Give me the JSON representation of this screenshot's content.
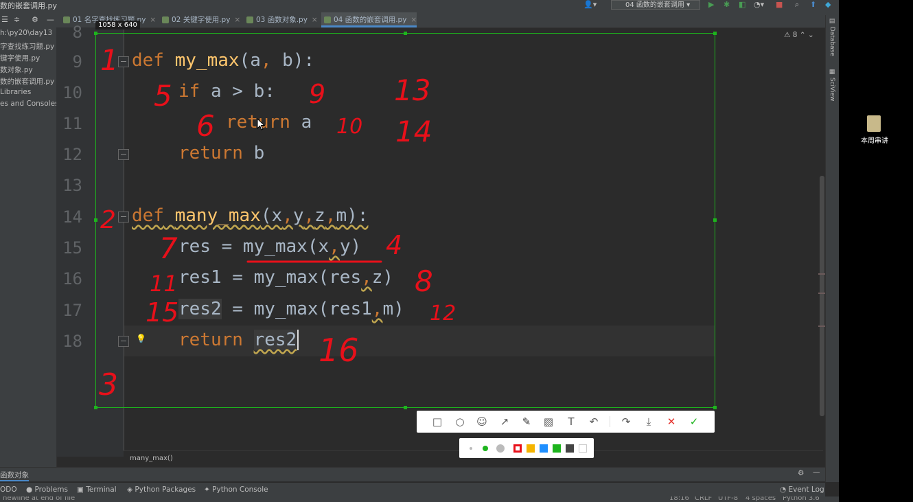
{
  "window_title": "数的嵌套调用.py",
  "editor_tabs": [
    {
      "label": "01 名字查找练习题.py",
      "active": false
    },
    {
      "label": "02 关键字使用.py",
      "active": false
    },
    {
      "label": "03 函数对象.py",
      "active": false
    },
    {
      "label": "04 函数的嵌套调用.py",
      "active": true
    }
  ],
  "run_config": "04 函数的嵌套调用",
  "project_tree": [
    "h:\\py20\\day13",
    "字查找练习题.py",
    "键字使用.py",
    "数对象.py",
    "数的嵌套调用.py",
    "Libraries",
    "es and Consoles"
  ],
  "line_numbers": [
    "8",
    "9",
    "10",
    "11",
    "12",
    "13",
    "14",
    "15",
    "16",
    "17",
    "18"
  ],
  "inspection_count": "8",
  "breadcrumb": "many_max()",
  "selection_size": "1058 x 640",
  "right_strip": [
    "Database",
    "SciView"
  ],
  "bottom_panel_title": "函数对象",
  "bottom_tabs": [
    "ODO",
    "Problems",
    "Terminal",
    "Python Packages",
    "Python Console"
  ],
  "event_log": "Event Log",
  "status_left": "newline at end of file",
  "status_right": [
    "18:16",
    "CRLF",
    "UTF-8",
    "4 spaces",
    "Python 3.6"
  ],
  "desktop_icon_label": "本周串讲",
  "annotations": [
    "1",
    "2",
    "3",
    "4",
    "5",
    "6",
    "7",
    "8",
    "9",
    "10",
    "11",
    "12",
    "13",
    "14",
    "15",
    "16"
  ],
  "colors": {
    "selection": "#1db41d",
    "pen": "#e8101a",
    "keyword": "#cc7832",
    "function": "#ffc66d"
  },
  "shot_tools": [
    "rectangle-icon",
    "ellipse-icon",
    "emoji-icon",
    "arrow-icon",
    "pen-icon",
    "mosaic-icon",
    "text-icon",
    "undo-icon",
    "share-icon",
    "download-icon",
    "cancel-icon",
    "confirm-icon"
  ]
}
